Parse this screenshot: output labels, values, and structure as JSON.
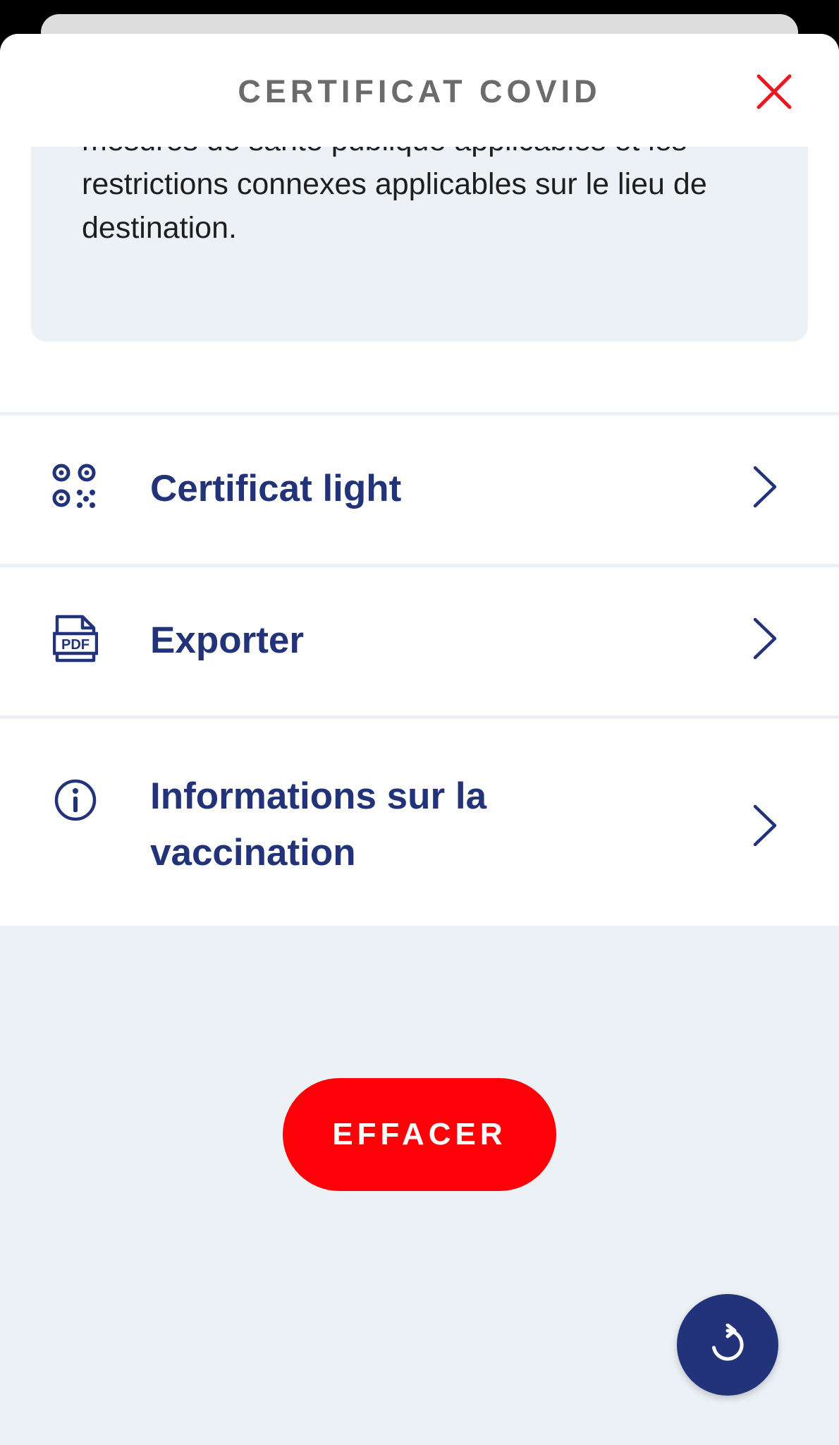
{
  "header": {
    "title": "CERTIFICAT COVID",
    "close_icon": "close-icon"
  },
  "info": {
    "text": "mesures de santé publique applicables et les restrictions connexes applicables sur le lieu de destination."
  },
  "menu": [
    {
      "label": "Certificat light",
      "icon": "qr-code-icon"
    },
    {
      "label": "Exporter",
      "icon": "pdf-file-icon"
    },
    {
      "label": "Informations sur la vaccination",
      "icon": "info-circle-icon"
    }
  ],
  "actions": {
    "delete_label": "EFFACER",
    "refresh_icon": "refresh-icon"
  },
  "colors": {
    "primary": "#22337a",
    "danger": "#fc0208",
    "background": "#ecf1f6",
    "title_gray": "#6b6b6b"
  }
}
